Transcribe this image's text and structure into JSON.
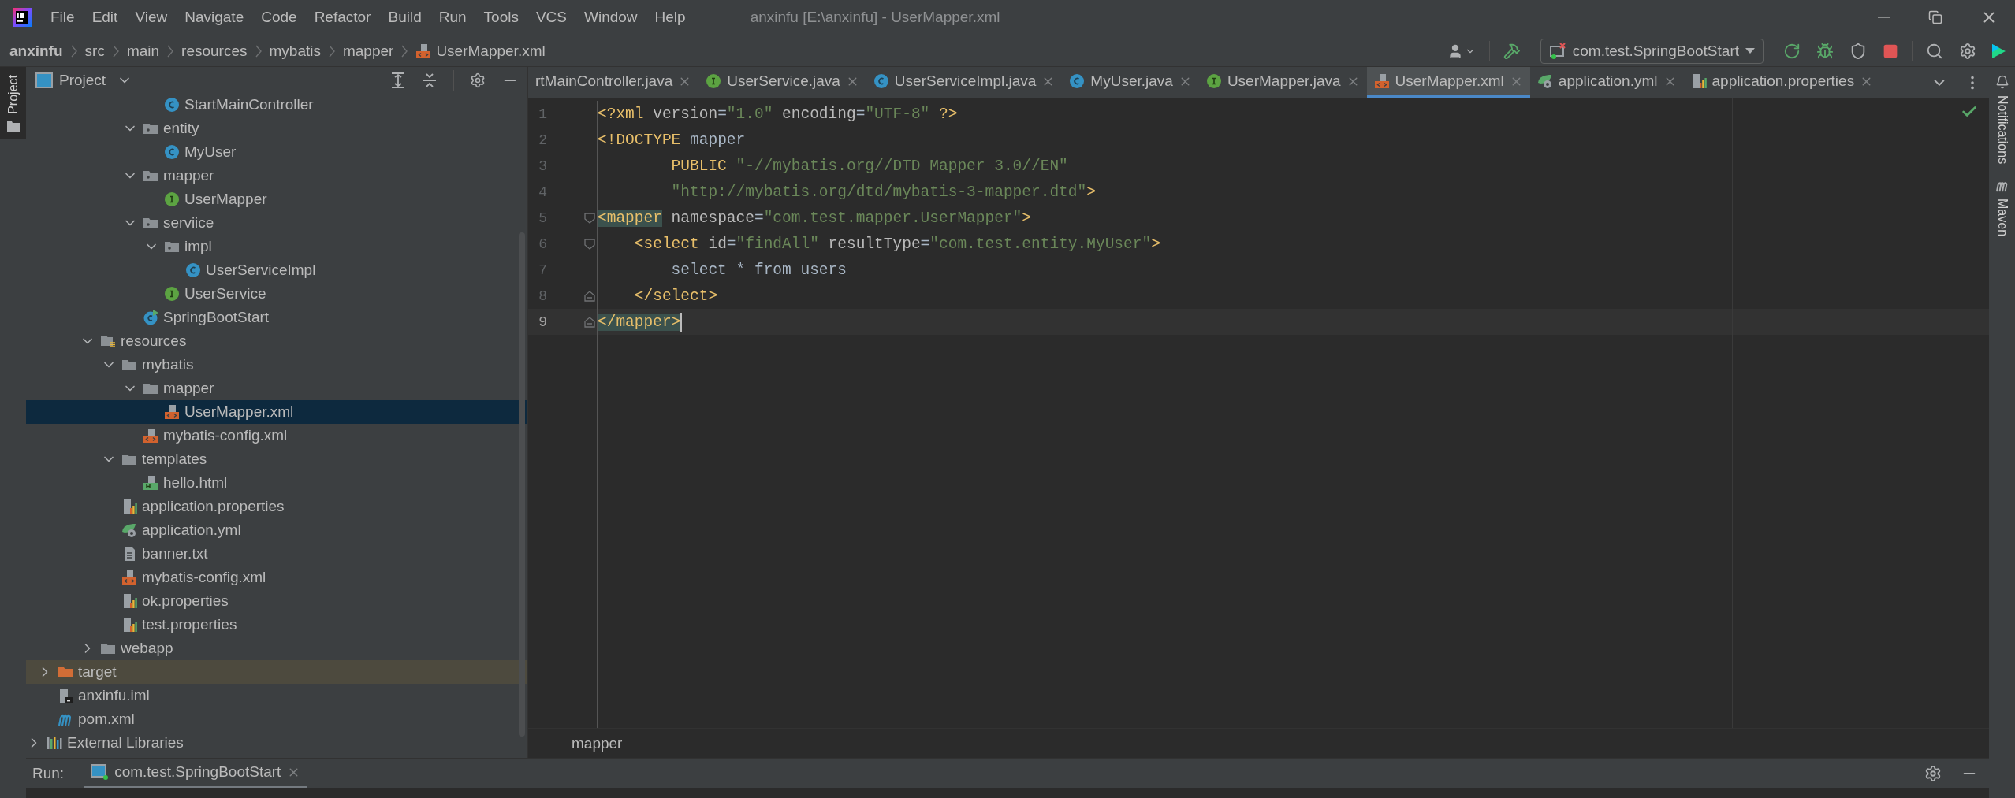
{
  "title_bar": {
    "menu": [
      "File",
      "Edit",
      "View",
      "Navigate",
      "Code",
      "Refactor",
      "Build",
      "Run",
      "Tools",
      "VCS",
      "Window",
      "Help"
    ],
    "title": "anxinfu [E:\\anxinfu] - UserMapper.xml"
  },
  "breadcrumb": [
    {
      "label": "anxinfu",
      "kind": "project"
    },
    {
      "label": "src",
      "kind": "dir"
    },
    {
      "label": "main",
      "kind": "dir"
    },
    {
      "label": "resources",
      "kind": "dir"
    },
    {
      "label": "mybatis",
      "kind": "dir"
    },
    {
      "label": "mapper",
      "kind": "dir"
    },
    {
      "label": "UserMapper.xml",
      "kind": "xml"
    }
  ],
  "run_config": {
    "label": "com.test.SpringBootStart"
  },
  "left_strip": [
    {
      "label": "Project",
      "selected": true
    }
  ],
  "right_strip": [
    {
      "label": "Notifications",
      "kind": "bell"
    },
    {
      "label": "Maven",
      "kind": "maven"
    }
  ],
  "project_panel": {
    "title": "Project",
    "tree": [
      {
        "children": [
          {
            "children": [
              {
                "children": [
                  {
                    "children": [
                      {
                        "children": [
                          {
                            "children": [
                              {
                                "label": "StartMainController",
                                "kind": "class",
                                "selected": false
                              }
                            ]
                          },
                          {
                            "label": "entity",
                            "kind": "package",
                            "expanded": true,
                            "selected": false,
                            "children": [
                              {
                                "label": "MyUser",
                                "kind": "class",
                                "selected": false
                              }
                            ]
                          },
                          {
                            "label": "mapper",
                            "kind": "package",
                            "expanded": true,
                            "selected": false,
                            "children": [
                              {
                                "label": "UserMapper",
                                "kind": "interface",
                                "selected": false
                              }
                            ]
                          },
                          {
                            "label": "serviice",
                            "kind": "package",
                            "expanded": true,
                            "selected": false,
                            "children": [
                              {
                                "label": "impl",
                                "kind": "package",
                                "expanded": true,
                                "selected": false,
                                "children": [
                                  {
                                    "label": "UserServiceImpl",
                                    "kind": "class",
                                    "selected": false
                                  }
                                ]
                              },
                              {
                                "label": "UserService",
                                "kind": "interface",
                                "selected": false
                              }
                            ]
                          },
                          {
                            "label": "SpringBootStart",
                            "kind": "main-class",
                            "selected": false
                          }
                        ]
                      }
                    ]
                  },
                  {
                    "label": "resources",
                    "kind": "resources",
                    "expanded": true,
                    "selected": false,
                    "children": [
                      {
                        "label": "mybatis",
                        "kind": "folder",
                        "expanded": true,
                        "selected": false,
                        "children": [
                          {
                            "label": "mapper",
                            "kind": "folder",
                            "expanded": true,
                            "selected": false,
                            "children": [
                              {
                                "label": "UserMapper.xml",
                                "kind": "xml",
                                "selected": true
                              }
                            ]
                          },
                          {
                            "label": "mybatis-config.xml",
                            "kind": "xml",
                            "selected": false
                          }
                        ]
                      },
                      {
                        "label": "templates",
                        "kind": "folder",
                        "expanded": true,
                        "selected": false,
                        "children": [
                          {
                            "label": "hello.html",
                            "kind": "html",
                            "selected": false
                          }
                        ]
                      },
                      {
                        "label": "application.properties",
                        "kind": "properties",
                        "selected": false
                      },
                      {
                        "label": "application.yml",
                        "kind": "yml",
                        "selected": false
                      },
                      {
                        "label": "banner.txt",
                        "kind": "text",
                        "selected": false
                      },
                      {
                        "label": "mybatis-config.xml",
                        "kind": "xml",
                        "selected": false
                      },
                      {
                        "label": "ok.properties",
                        "kind": "properties",
                        "selected": false
                      },
                      {
                        "label": "test.properties",
                        "kind": "properties",
                        "selected": false
                      }
                    ]
                  },
                  {
                    "label": "webapp",
                    "kind": "folder",
                    "expanded": false,
                    "selected": false
                  }
                ]
              }
            ]
          },
          {
            "label": "target",
            "kind": "excluded",
            "expanded": false,
            "selected": false
          },
          {
            "label": "anxinfu.iml",
            "kind": "iml",
            "selected": false
          },
          {
            "label": "pom.xml",
            "kind": "maven",
            "selected": false
          }
        ]
      },
      {
        "label": "External Libraries",
        "kind": "libraries",
        "expanded": false,
        "selected": false
      }
    ]
  },
  "editor": {
    "tabs": [
      {
        "label": "rtMainController.java",
        "kind": "none",
        "selected": false
      },
      {
        "label": "UserService.java",
        "kind": "interface",
        "selected": false
      },
      {
        "label": "UserServiceImpl.java",
        "kind": "class",
        "selected": false
      },
      {
        "label": "MyUser.java",
        "kind": "class",
        "selected": false
      },
      {
        "label": "UserMapper.java",
        "kind": "interface",
        "selected": false
      },
      {
        "label": "UserMapper.xml",
        "kind": "xml",
        "selected": true
      },
      {
        "label": "application.yml",
        "kind": "yml",
        "selected": false
      },
      {
        "label": "application.properties",
        "kind": "properties",
        "selected": false
      }
    ],
    "lines": [
      {
        "number": "1",
        "current": false,
        "tokens": [
          {
            "kind": "tag",
            "text": "<?xml "
          },
          {
            "kind": "attr",
            "text": "version"
          },
          {
            "kind": "text",
            "text": "="
          },
          {
            "kind": "value",
            "text": "\"1.0\""
          },
          {
            "kind": "attr",
            "text": " encoding"
          },
          {
            "kind": "text",
            "text": "="
          },
          {
            "kind": "value",
            "text": "\"UTF-8\""
          },
          {
            "kind": "tag",
            "text": " ?>"
          }
        ]
      },
      {
        "number": "2",
        "current": false,
        "tokens": [
          {
            "kind": "tag",
            "text": "<!DOCTYPE"
          },
          {
            "kind": "text",
            "text": " mapper"
          }
        ]
      },
      {
        "number": "3",
        "current": false,
        "tokens": [
          {
            "kind": "tag",
            "text": "        PUBLIC"
          },
          {
            "kind": "value",
            "text": " \"-//mybatis.org//DTD Mapper 3.0//EN\""
          }
        ]
      },
      {
        "number": "4",
        "current": false,
        "tokens": [
          {
            "kind": "value",
            "text": "        \"http://mybatis.org/dtd/mybatis-3-mapper.dtd\""
          },
          {
            "kind": "tag",
            "text": ">"
          }
        ]
      },
      {
        "number": "5",
        "current": false,
        "fold_open": true,
        "fold_close": false,
        "tokens": [
          {
            "kind": "match",
            "text": "<mapper"
          },
          {
            "kind": "attr",
            "text": " namespace"
          },
          {
            "kind": "text",
            "text": "="
          },
          {
            "kind": "value",
            "text": "\"com.test.mapper.UserMapper\""
          },
          {
            "kind": "tag",
            "text": ">"
          }
        ]
      },
      {
        "number": "6",
        "current": false,
        "fold_open": true,
        "fold_close": false,
        "tokens": [
          {
            "kind": "tag",
            "text": "    <select"
          },
          {
            "kind": "attr",
            "text": " id"
          },
          {
            "kind": "text",
            "text": "="
          },
          {
            "kind": "value",
            "text": "\"findAll\""
          },
          {
            "kind": "attr",
            "text": " resultType"
          },
          {
            "kind": "text",
            "text": "="
          },
          {
            "kind": "value",
            "text": "\"com.test.entity.MyUser\""
          },
          {
            "kind": "tag",
            "text": ">"
          }
        ]
      },
      {
        "number": "7",
        "current": false,
        "tokens": [
          {
            "kind": "text",
            "text": "        select * from users"
          }
        ]
      },
      {
        "number": "8",
        "current": false,
        "fold_open": false,
        "fold_close": true,
        "tokens": [
          {
            "kind": "tag",
            "text": "    </select>"
          }
        ]
      },
      {
        "number": "9",
        "current": true,
        "fold_open": false,
        "fold_close": true,
        "tokens": [
          {
            "kind": "match",
            "text": "</mapper>"
          }
        ]
      }
    ],
    "breadcrumb": "mapper"
  },
  "run_bar": {
    "label": "Run:",
    "tabs": [
      {
        "label": "com.test.SpringBootStart",
        "selected": true
      }
    ]
  }
}
